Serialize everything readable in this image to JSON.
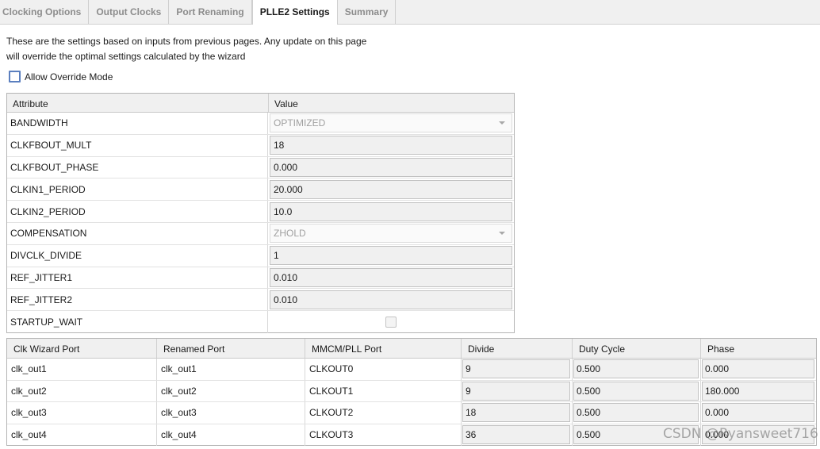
{
  "tabs": [
    {
      "label": "Clocking Options",
      "active": false
    },
    {
      "label": "Output Clocks",
      "active": false
    },
    {
      "label": "Port Renaming",
      "active": false
    },
    {
      "label": "PLLE2 Settings",
      "active": true
    },
    {
      "label": "Summary",
      "active": false
    }
  ],
  "intro": {
    "line1": "These are the settings based on inputs from previous pages. Any update on this page",
    "line2": "will override the optimal settings calculated by the wizard"
  },
  "override": {
    "label": "Allow Override Mode",
    "checked": false
  },
  "attributes": {
    "header": {
      "attribute": "Attribute",
      "value": "Value"
    },
    "rows": [
      {
        "name": "BANDWIDTH",
        "value": "OPTIMIZED",
        "kind": "combo"
      },
      {
        "name": "CLKFBOUT_MULT",
        "value": "18",
        "kind": "field"
      },
      {
        "name": "CLKFBOUT_PHASE",
        "value": "0.000",
        "kind": "field"
      },
      {
        "name": "CLKIN1_PERIOD",
        "value": "20.000",
        "kind": "field"
      },
      {
        "name": "CLKIN2_PERIOD",
        "value": "10.0",
        "kind": "field"
      },
      {
        "name": "COMPENSATION",
        "value": "ZHOLD",
        "kind": "combo"
      },
      {
        "name": "DIVCLK_DIVIDE",
        "value": "1",
        "kind": "field"
      },
      {
        "name": "REF_JITTER1",
        "value": "0.010",
        "kind": "field"
      },
      {
        "name": "REF_JITTER2",
        "value": "0.010",
        "kind": "field"
      },
      {
        "name": "STARTUP_WAIT",
        "value": "",
        "kind": "checkbox"
      }
    ]
  },
  "ports": {
    "header": {
      "wizard_port": "Clk Wizard Port",
      "renamed_port": "Renamed Port",
      "mmcm_port": "MMCM/PLL Port",
      "divide": "Divide",
      "duty_cycle": "Duty Cycle",
      "phase": "Phase"
    },
    "rows": [
      {
        "wizard_port": "clk_out1",
        "renamed_port": "clk_out1",
        "mmcm_port": "CLKOUT0",
        "divide": "9",
        "duty_cycle": "0.500",
        "phase": "0.000"
      },
      {
        "wizard_port": "clk_out2",
        "renamed_port": "clk_out2",
        "mmcm_port": "CLKOUT1",
        "divide": "9",
        "duty_cycle": "0.500",
        "phase": "180.000"
      },
      {
        "wizard_port": "clk_out3",
        "renamed_port": "clk_out3",
        "mmcm_port": "CLKOUT2",
        "divide": "18",
        "duty_cycle": "0.500",
        "phase": "0.000"
      },
      {
        "wizard_port": "clk_out4",
        "renamed_port": "clk_out4",
        "mmcm_port": "CLKOUT3",
        "divide": "36",
        "duty_cycle": "0.500",
        "phase": "0.000"
      }
    ]
  },
  "watermark": "CSDN @Ryansweet716",
  "colors": {
    "tab_bar_bg": "#f0f0f0",
    "field_bg": "#f0f0f0",
    "checkbox_border": "#5b7fbf",
    "disabled_text": "#a0a0a0"
  }
}
